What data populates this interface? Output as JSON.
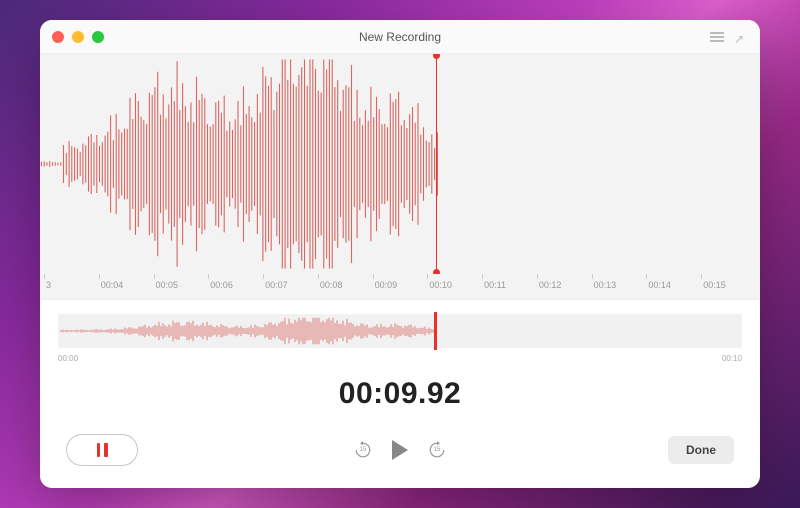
{
  "titlebar": {
    "title": "New Recording"
  },
  "waveform": {
    "playhead_fraction": 0.55
  },
  "ruler": {
    "ticks": [
      "3",
      "00:04",
      "00:05",
      "00:06",
      "00:07",
      "00:08",
      "00:09",
      "00:10",
      "00:11",
      "00:12",
      "00:13",
      "00:14",
      "00:15"
    ]
  },
  "overview": {
    "start_label": "00:00",
    "end_label": "00:10",
    "playhead_fraction": 0.55
  },
  "timecode": "00:09.92",
  "controls": {
    "skip_back_seconds": "15",
    "skip_forward_seconds": "15",
    "done_label": "Done"
  }
}
